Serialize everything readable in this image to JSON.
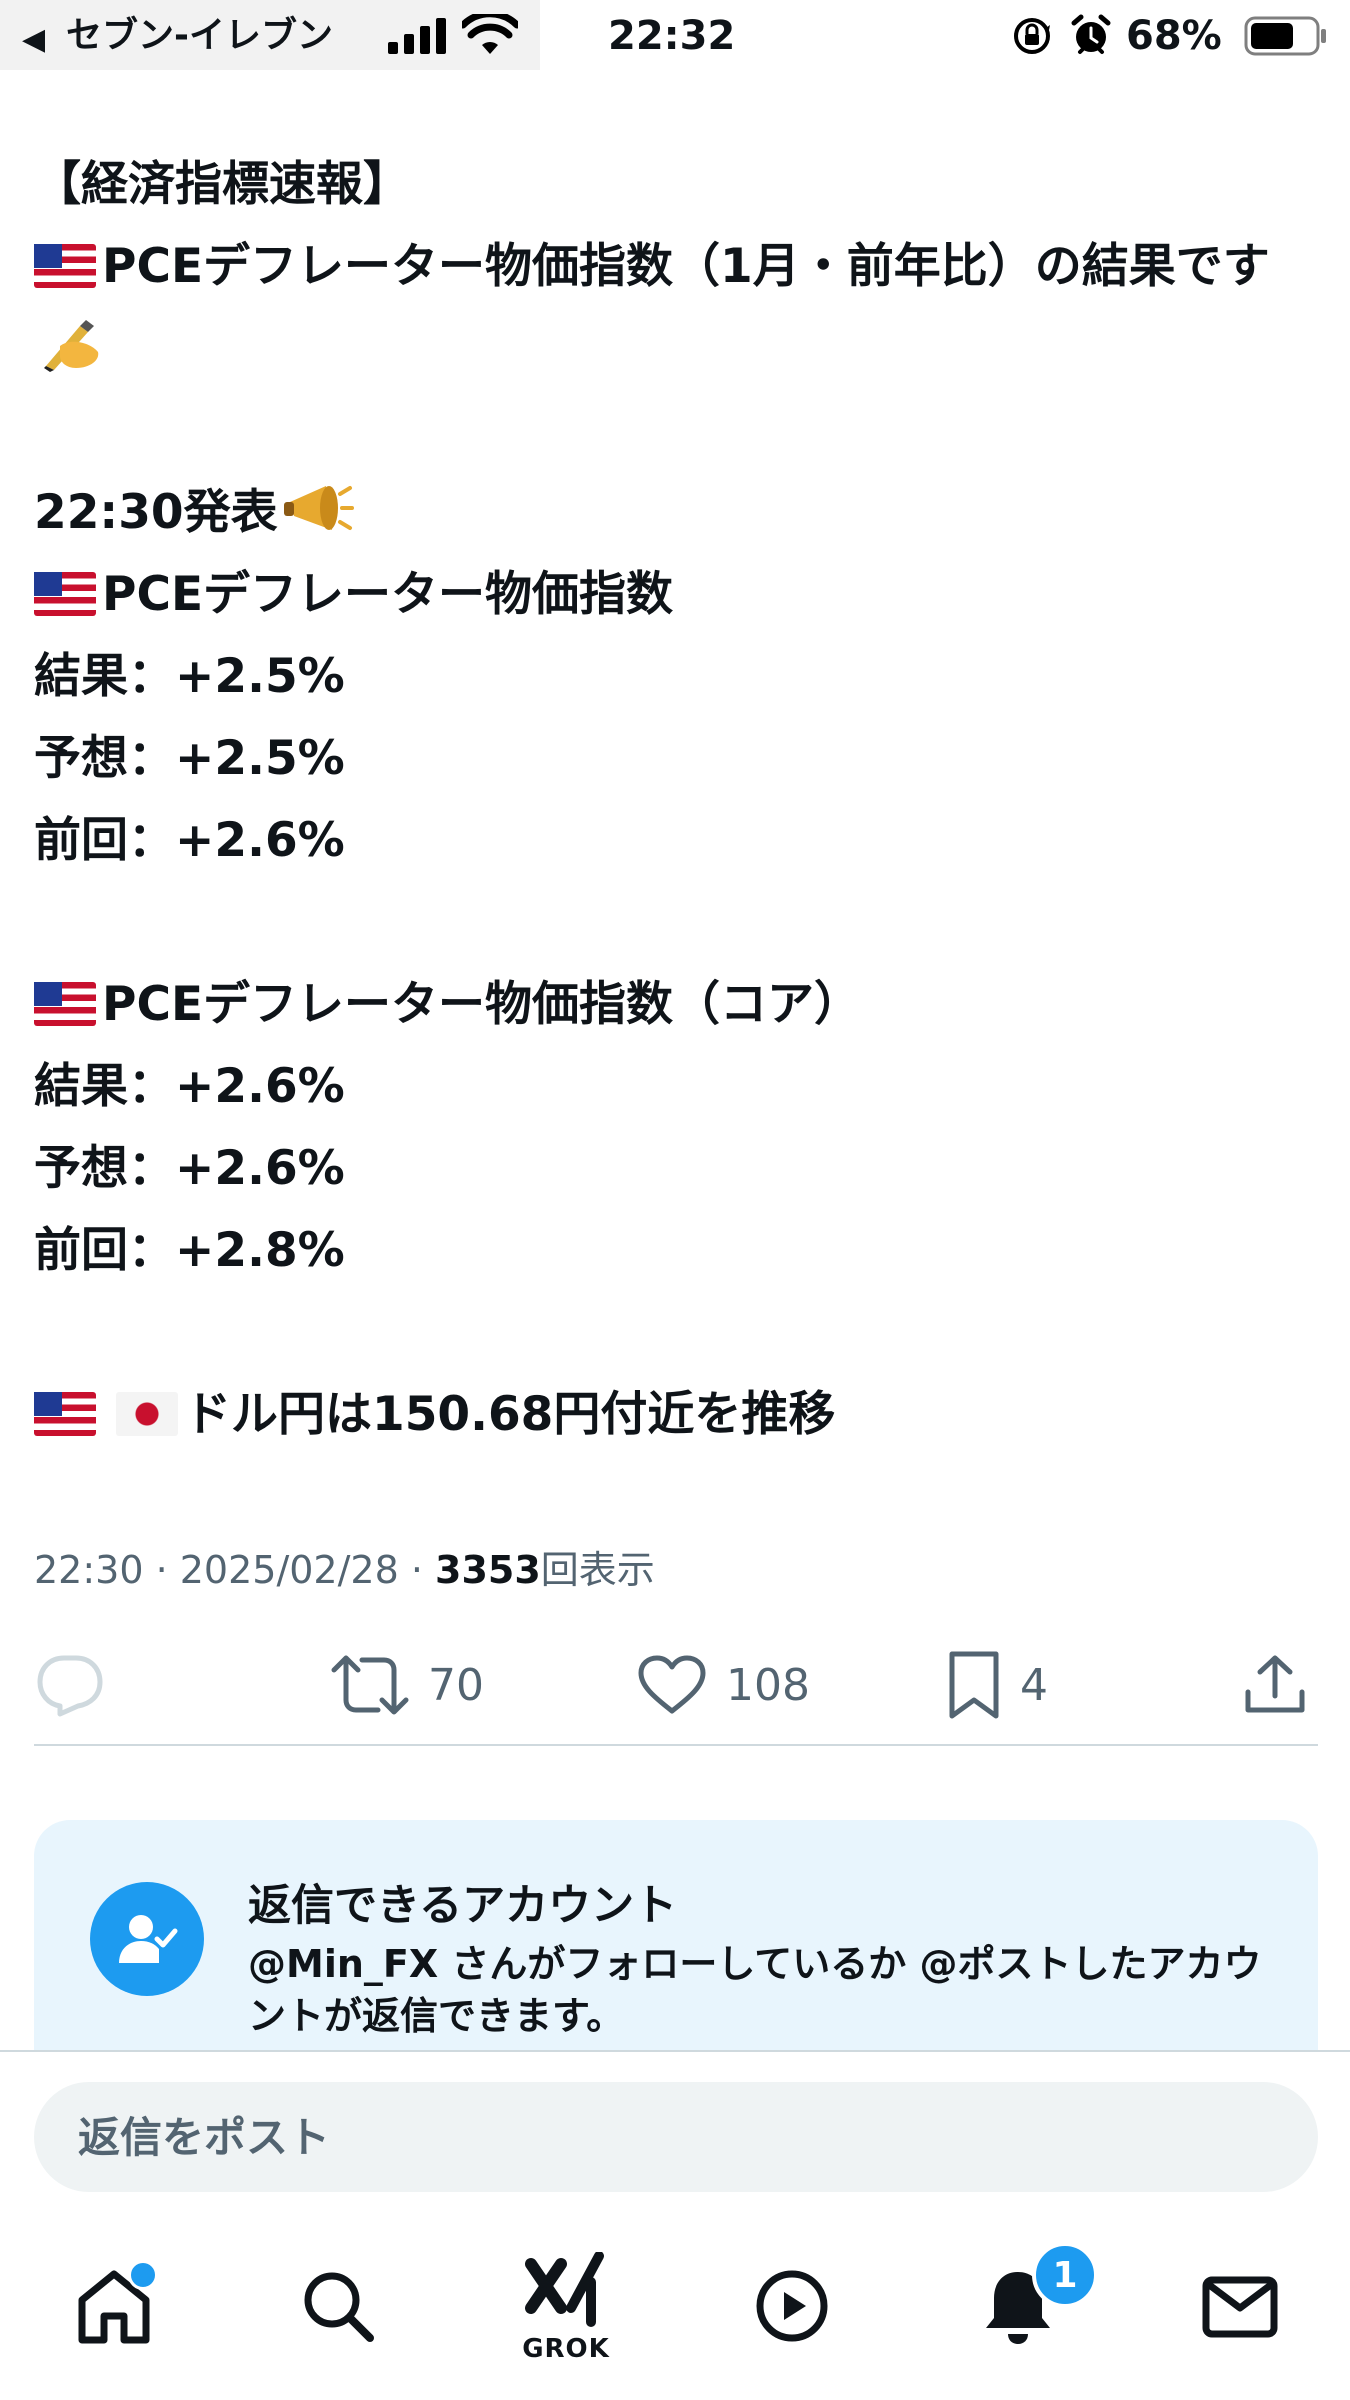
{
  "status_bar": {
    "back_glyph": "◀",
    "carrier": "セブン-イレブン",
    "time": "22:32",
    "battery_percent": "68%",
    "battery_level": 0.68
  },
  "post": {
    "lines": {
      "header": "【経済指標速報】",
      "title": "PCEデフレーター物価指数（1月・前年比）の結果です",
      "release_time": "22:30発表",
      "pce_label": "PCEデフレーター物価指数",
      "pce_result": "結果：+2.5%",
      "pce_forecast": "予想：+2.5%",
      "pce_previous": "前回：+2.6%",
      "core_label": "PCEデフレーター物価指数（コア）",
      "core_result": "結果：+2.6%",
      "core_forecast": "予想：+2.6%",
      "core_previous": "前回：+2.8%",
      "usdjpy": "ドル円は150.68円付近を推移"
    },
    "emoji": {
      "writing_hand": "✍",
      "megaphone": "📣"
    },
    "meta": {
      "time_date": "22:30 · 2025/02/28 · ",
      "views_count": "3353",
      "views_label": "回表示"
    },
    "actions": {
      "reply_count": "",
      "repost_count": "70",
      "like_count": "108",
      "bookmark_count": "4"
    }
  },
  "reply_restriction": {
    "title": "返信できるアカウント",
    "description": "@Min_FX さんがフォローしているか @ポストしたアカウントが返信できます。"
  },
  "reply_input": {
    "placeholder": "返信をポスト"
  },
  "bottom_nav": {
    "grok_label": "GROK",
    "notification_badge": "1"
  },
  "colors": {
    "accent": "#1d9bf0",
    "text_primary": "#0f1419",
    "text_secondary": "#536471",
    "card_background": "#e8f5fd",
    "divider": "#cfd9de"
  }
}
